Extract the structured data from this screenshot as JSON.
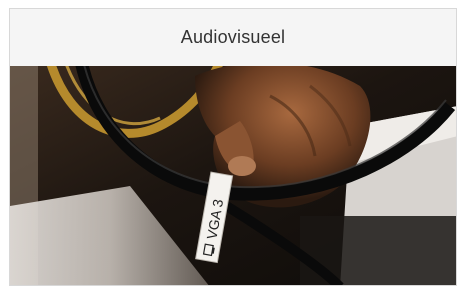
{
  "card": {
    "title": "Audiovisueel"
  },
  "photo": {
    "subject_icon": "vga-cable-photo-icon",
    "cable_label": "VGA 3"
  },
  "colors": {
    "card_background": "#f5f5f5",
    "card_border": "#d8d8d8",
    "title_text": "#333333"
  }
}
